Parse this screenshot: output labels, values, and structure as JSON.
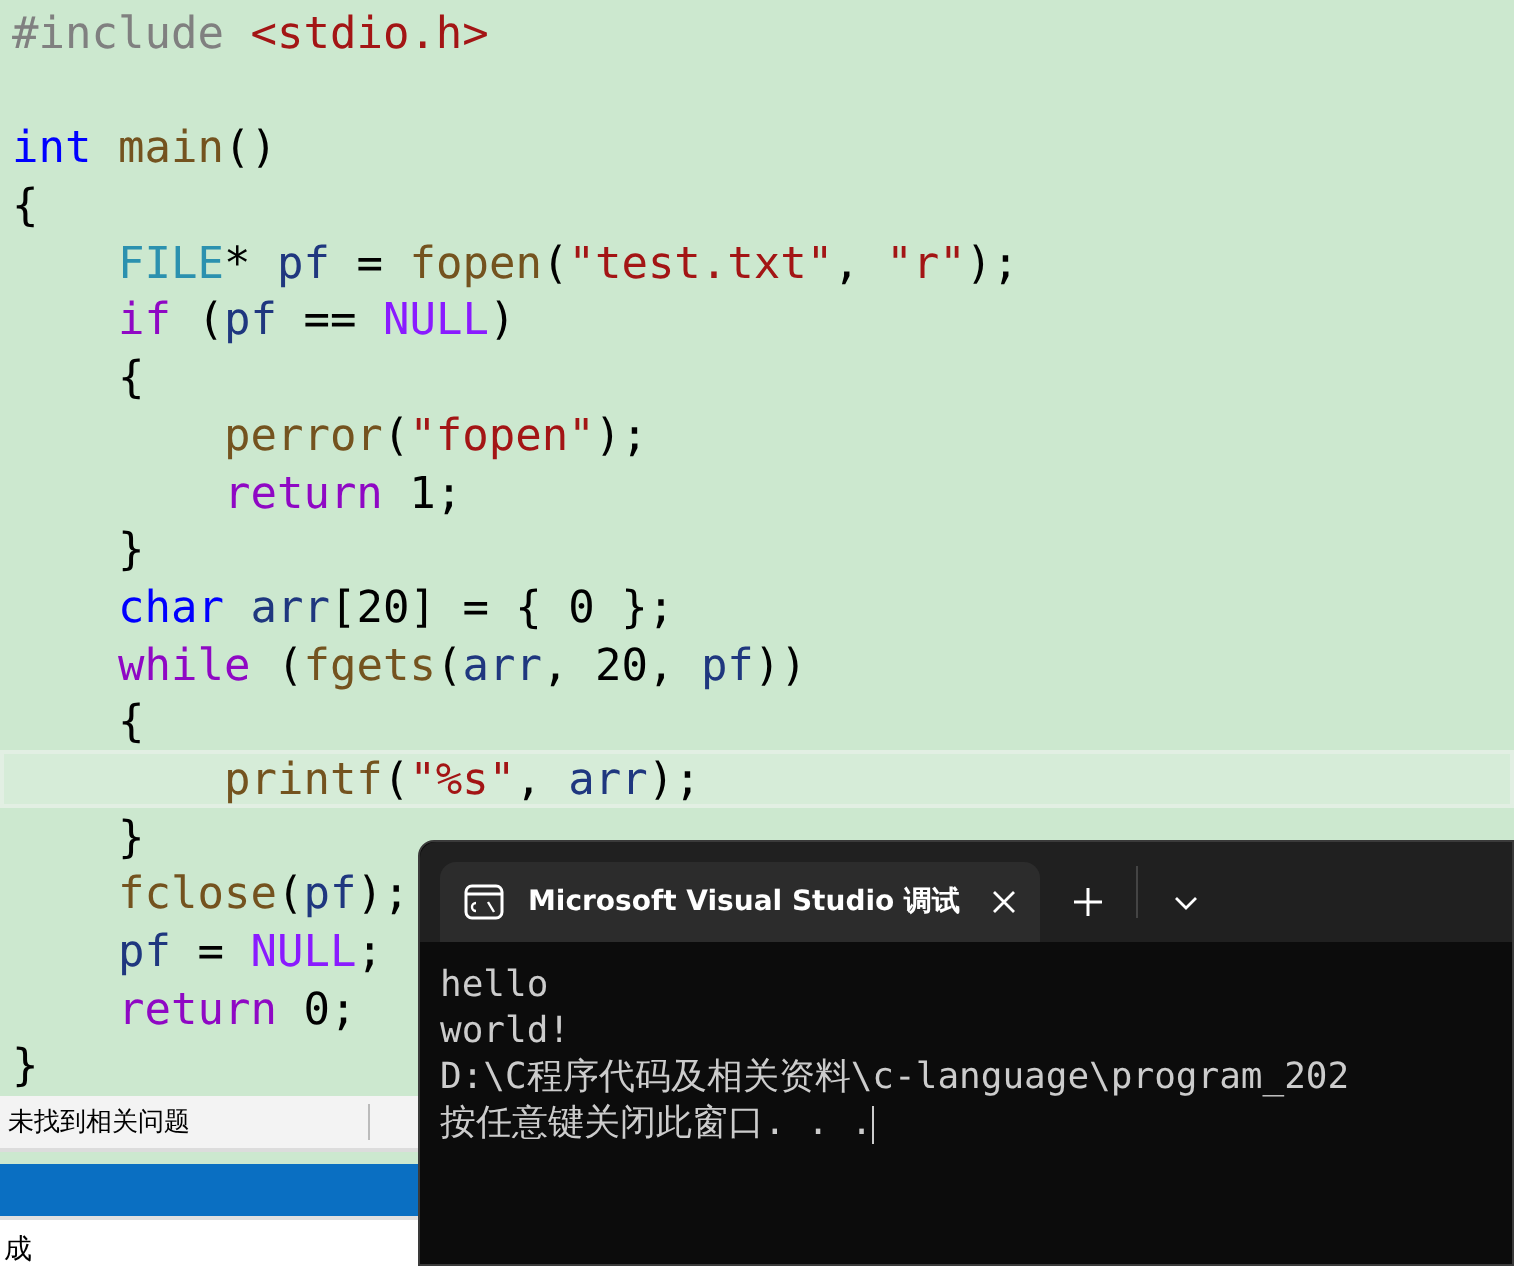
{
  "editor": {
    "lines": [
      {
        "current": false,
        "tokens": [
          {
            "text": "#include ",
            "kind": "preproc"
          },
          {
            "text": "<stdio.h>",
            "kind": "string"
          }
        ]
      },
      {
        "current": false
      },
      {
        "current": false,
        "tokens": [
          {
            "text": "int ",
            "kind": "keyword"
          },
          {
            "text": "main",
            "kind": "func"
          },
          {
            "text": "()",
            "kind": "plain"
          }
        ]
      },
      {
        "current": false,
        "tokens": [
          {
            "text": "{",
            "kind": "plain"
          }
        ]
      },
      {
        "current": false,
        "tokens": [
          {
            "text": "    FILE",
            "kind": "type"
          },
          {
            "text": "* ",
            "kind": "plain"
          },
          {
            "text": "pf",
            "kind": "ident"
          },
          {
            "text": " = ",
            "kind": "plain"
          },
          {
            "text": "fopen",
            "kind": "func"
          },
          {
            "text": "(",
            "kind": "plain"
          },
          {
            "text": "\"test.txt\"",
            "kind": "string"
          },
          {
            "text": ", ",
            "kind": "plain"
          },
          {
            "text": "\"r\"",
            "kind": "string"
          },
          {
            "text": ");",
            "kind": "plain"
          }
        ]
      },
      {
        "current": false,
        "tokens": [
          {
            "text": "    if",
            "kind": "control"
          },
          {
            "text": " (",
            "kind": "plain"
          },
          {
            "text": "pf",
            "kind": "ident"
          },
          {
            "text": " == ",
            "kind": "plain"
          },
          {
            "text": "NULL",
            "kind": "macro"
          },
          {
            "text": ")",
            "kind": "plain"
          }
        ]
      },
      {
        "current": false,
        "tokens": [
          {
            "text": "    {",
            "kind": "plain"
          }
        ]
      },
      {
        "current": false,
        "tokens": [
          {
            "text": "        perror",
            "kind": "func"
          },
          {
            "text": "(",
            "kind": "plain"
          },
          {
            "text": "\"fopen\"",
            "kind": "string"
          },
          {
            "text": ");",
            "kind": "plain"
          }
        ]
      },
      {
        "current": false,
        "tokens": [
          {
            "text": "        return",
            "kind": "control"
          },
          {
            "text": " 1;",
            "kind": "plain"
          }
        ]
      },
      {
        "current": false,
        "tokens": [
          {
            "text": "    }",
            "kind": "plain"
          }
        ]
      },
      {
        "current": false,
        "tokens": [
          {
            "text": "    char ",
            "kind": "keyword"
          },
          {
            "text": "arr",
            "kind": "ident"
          },
          {
            "text": "[20] = { 0 };",
            "kind": "plain"
          }
        ]
      },
      {
        "current": false,
        "tokens": [
          {
            "text": "    while",
            "kind": "control"
          },
          {
            "text": " (",
            "kind": "plain"
          },
          {
            "text": "fgets",
            "kind": "func"
          },
          {
            "text": "(",
            "kind": "plain"
          },
          {
            "text": "arr",
            "kind": "ident"
          },
          {
            "text": ", 20, ",
            "kind": "plain"
          },
          {
            "text": "pf",
            "kind": "ident"
          },
          {
            "text": "))",
            "kind": "plain"
          }
        ]
      },
      {
        "current": false,
        "tokens": [
          {
            "text": "    {",
            "kind": "plain"
          }
        ]
      },
      {
        "current": true,
        "tokens": [
          {
            "text": "        printf",
            "kind": "func"
          },
          {
            "text": "(",
            "kind": "plain"
          },
          {
            "text": "\"%s\"",
            "kind": "string"
          },
          {
            "text": ", ",
            "kind": "plain"
          },
          {
            "text": "arr",
            "kind": "ident"
          },
          {
            "text": ");",
            "kind": "plain"
          }
        ]
      },
      {
        "current": false,
        "tokens": [
          {
            "text": "    }",
            "kind": "plain"
          }
        ]
      },
      {
        "current": false,
        "tokens": [
          {
            "text": "    fclose",
            "kind": "func"
          },
          {
            "text": "(",
            "kind": "plain"
          },
          {
            "text": "pf",
            "kind": "ident"
          },
          {
            "text": ");",
            "kind": "plain"
          }
        ]
      },
      {
        "current": false,
        "tokens": [
          {
            "text": "    pf",
            "kind": "ident"
          },
          {
            "text": " = ",
            "kind": "plain"
          },
          {
            "text": "NULL",
            "kind": "macro"
          },
          {
            "text": ";",
            "kind": "plain"
          }
        ]
      },
      {
        "current": false,
        "tokens": [
          {
            "text": "    return",
            "kind": "control"
          },
          {
            "text": " 0;",
            "kind": "plain"
          }
        ]
      },
      {
        "current": false,
        "tokens": [
          {
            "text": "}",
            "kind": "plain"
          }
        ]
      }
    ]
  },
  "error_list": {
    "status": "未找到相关问题"
  },
  "output_panel": {
    "text": "成"
  },
  "console": {
    "tab_title": "Microsoft Visual Studio 调试",
    "lines": [
      "hello",
      "world!",
      "D:\\C程序代码及相关资料\\c-language\\program_202",
      "按任意键关闭此窗口. . ."
    ]
  }
}
